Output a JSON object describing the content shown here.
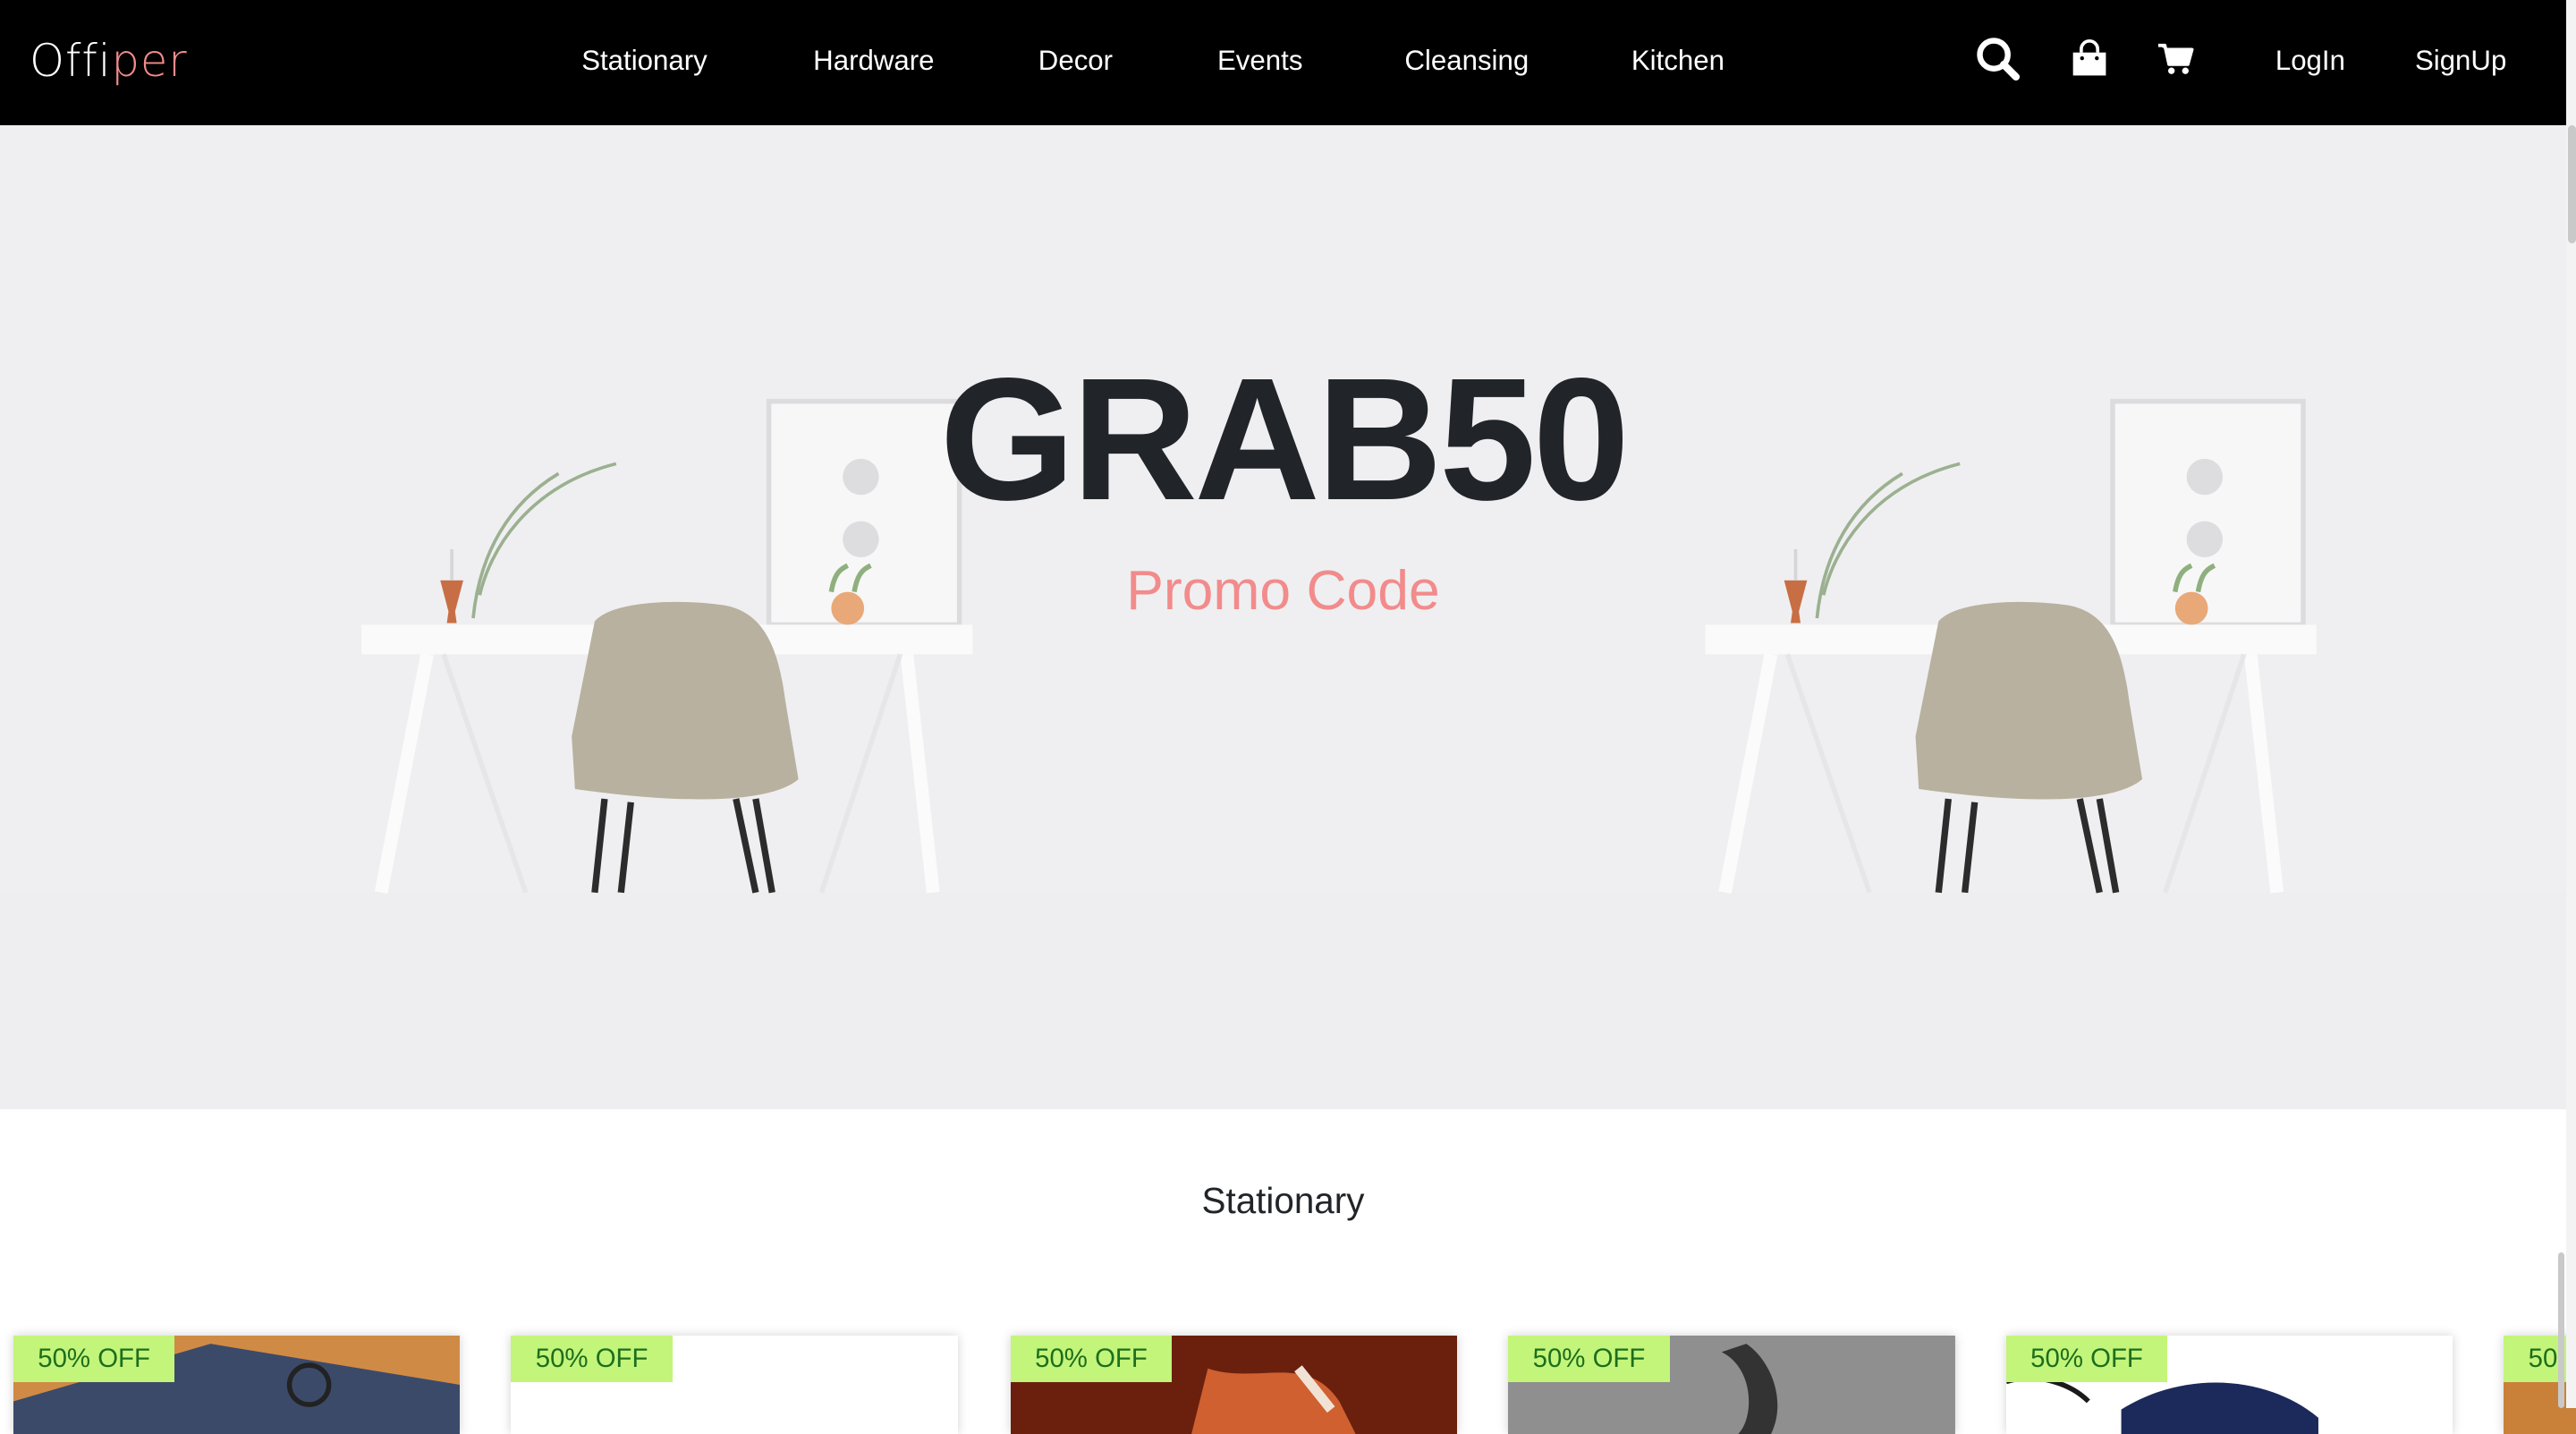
{
  "brand": {
    "part1": "Offi",
    "part2": "per"
  },
  "nav": {
    "links": [
      "Stationary",
      "Hardware",
      "Decor",
      "Events",
      "Cleansing",
      "Kitchen"
    ],
    "login": "LogIn",
    "signup": "SignUp",
    "icons": [
      "search-icon",
      "shopping-bag-icon",
      "cart-icon"
    ]
  },
  "hero": {
    "code": "GRAB50",
    "subtitle": "Promo Code"
  },
  "section": {
    "title": "Stationary",
    "badges": [
      "50% OFF",
      "50% OFF",
      "50% OFF",
      "50% OFF",
      "50% OFF",
      "50"
    ]
  },
  "colors": {
    "accent": "#f28b8b",
    "navbar": "#000000",
    "badge_bg": "#c3f57a",
    "badge_text": "#1d6e1d"
  }
}
